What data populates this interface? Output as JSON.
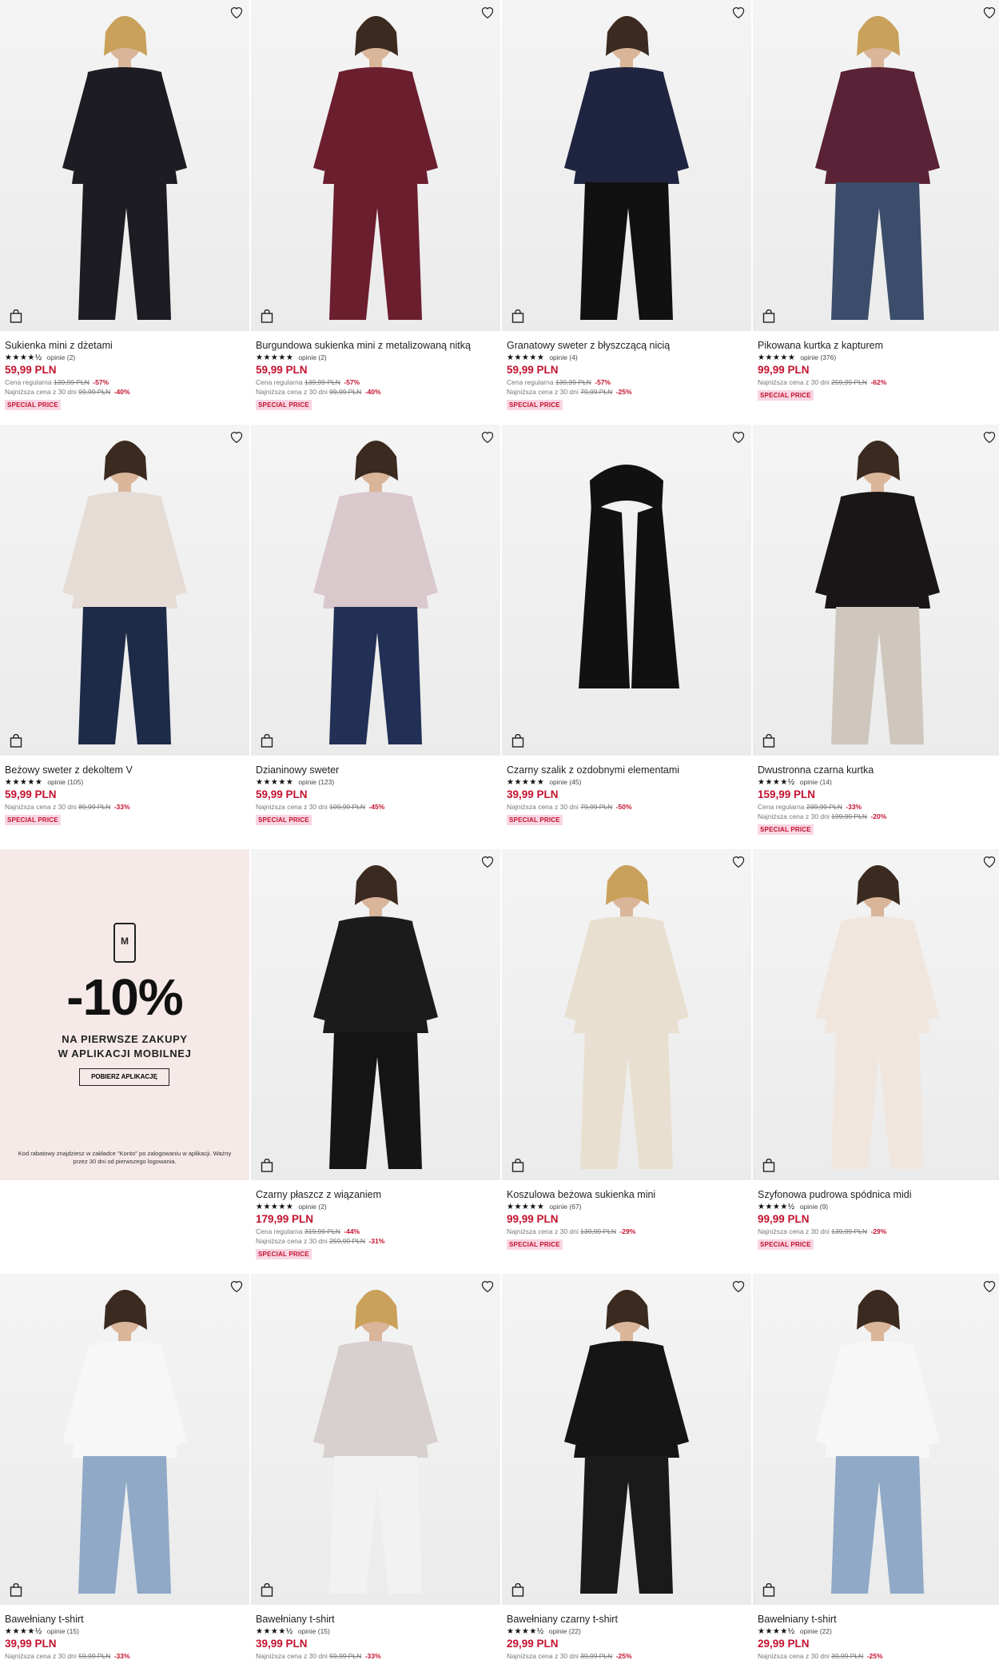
{
  "icons": {
    "wishlist": "heart-outline-icon",
    "add_to_cart": "shopping-bag-icon",
    "phone": "mobile-phone-icon"
  },
  "colors": {
    "price": "#c4122f",
    "badge_bg": "#f9d5e3",
    "badge_text": "#c4122f",
    "promo_bg": "#f5eae8"
  },
  "products": [
    {
      "name": "Sukienka mini z dżetami",
      "stars": "★★★★½",
      "reviews": "opinie (2)",
      "price": "59,99 PLN",
      "ref1_label": "Cena regularna",
      "ref1_old": "139,99 PLN",
      "ref1_pct": "-57%",
      "ref2_label": "Najniższa cena z 30 dni",
      "ref2_old": "99,99 PLN",
      "ref2_pct": "-40%",
      "badge": "SPECIAL PRICE"
    },
    {
      "name": "Burgundowa sukienka mini z metalizowaną nitką",
      "stars": "★★★★★",
      "reviews": "opinie (2)",
      "price": "59,99 PLN",
      "ref1_label": "Cena regularna",
      "ref1_old": "139,99 PLN",
      "ref1_pct": "-57%",
      "ref2_label": "Najniższa cena z 30 dni",
      "ref2_old": "99,99 PLN",
      "ref2_pct": "-40%",
      "badge": "SPECIAL PRICE"
    },
    {
      "name": "Granatowy sweter z błyszczącą nicią",
      "stars": "★★★★★",
      "reviews": "opinie (4)",
      "price": "59,99 PLN",
      "ref1_label": "Cena regularna",
      "ref1_old": "139,99 PLN",
      "ref1_pct": "-57%",
      "ref2_label": "Najniższa cena z 30 dni",
      "ref2_old": "79,99 PLN",
      "ref2_pct": "-25%",
      "badge": "SPECIAL PRICE"
    },
    {
      "name": "Pikowana kurtka z kapturem",
      "stars": "★★★★★",
      "reviews": "opinie (376)",
      "price": "99,99 PLN",
      "ref1_label": "Najniższa cena z 30 dni",
      "ref1_old": "259,99 PLN",
      "ref1_pct": "-62%",
      "badge": "SPECIAL PRICE"
    },
    {
      "name": "Beżowy sweter z dekoltem V",
      "stars": "★★★★★",
      "reviews": "opinie (105)",
      "price": "59,99 PLN",
      "ref1_label": "Najniższa cena z 30 dni",
      "ref1_old": "89,99 PLN",
      "ref1_pct": "-33%",
      "badge": "SPECIAL PRICE"
    },
    {
      "name": "Dzianinowy sweter",
      "stars": "★★★★★",
      "reviews": "opinie (123)",
      "price": "59,99 PLN",
      "ref1_label": "Najniższa cena z 30 dni",
      "ref1_old": "109,99 PLN",
      "ref1_pct": "-45%",
      "badge": "SPECIAL PRICE"
    },
    {
      "name": "Czarny szalik z ozdobnymi elementami",
      "stars": "★★★★★",
      "reviews": "opinie (45)",
      "price": "39,99 PLN",
      "ref1_label": "Najniższa cena z 30 dni",
      "ref1_old": "79,99 PLN",
      "ref1_pct": "-50%",
      "badge": "SPECIAL PRICE"
    },
    {
      "name": "Dwustronna czarna kurtka",
      "stars": "★★★★½",
      "reviews": "opinie (14)",
      "price": "159,99 PLN",
      "ref1_label": "Cena regularna",
      "ref1_old": "239,99 PLN",
      "ref1_pct": "-33%",
      "ref2_label": "Najniższa cena z 30 dni",
      "ref2_old": "199,99 PLN",
      "ref2_pct": "-20%",
      "badge": "SPECIAL PRICE"
    },
    {
      "name": "Czarny płaszcz z wiązaniem",
      "stars": "★★★★★",
      "reviews": "opinie (2)",
      "price": "179,99 PLN",
      "ref1_label": "Cena regularna",
      "ref1_old": "319,99 PLN",
      "ref1_pct": "-44%",
      "ref2_label": "Najniższa cena z 30 dni",
      "ref2_old": "259,99 PLN",
      "ref2_pct": "-31%",
      "badge": "SPECIAL PRICE"
    },
    {
      "name": "Koszulowa beżowa sukienka mini",
      "stars": "★★★★★",
      "reviews": "opinie (67)",
      "price": "99,99 PLN",
      "ref1_label": "Najniższa cena z 30 dni",
      "ref1_old": "139,99 PLN",
      "ref1_pct": "-29%",
      "badge": "SPECIAL PRICE"
    },
    {
      "name": "Szyfonowa pudrowa spódnica midi",
      "stars": "★★★★½",
      "reviews": "opinie (9)",
      "price": "99,99 PLN",
      "ref1_label": "Najniższa cena z 30 dni",
      "ref1_old": "139,99 PLN",
      "ref1_pct": "-29%",
      "badge": "SPECIAL PRICE"
    },
    {
      "name": "Bawełniany t-shirt",
      "stars": "★★★★½",
      "reviews": "opinie (15)",
      "price": "39,99 PLN",
      "ref1_label": "Najniższa cena z 30 dni",
      "ref1_old": "59,99 PLN",
      "ref1_pct": "-33%"
    },
    {
      "name": "Bawełniany t-shirt",
      "stars": "★★★★½",
      "reviews": "opinie (15)",
      "price": "39,99 PLN",
      "ref1_label": "Najniższa cena z 30 dni",
      "ref1_old": "59,99 PLN",
      "ref1_pct": "-33%"
    },
    {
      "name": "Bawełniany czarny t-shirt",
      "stars": "★★★★½",
      "reviews": "opinie (22)",
      "price": "29,99 PLN",
      "ref1_label": "Najniższa cena z 30 dni",
      "ref1_old": "39,99 PLN",
      "ref1_pct": "-25%"
    },
    {
      "name": "Bawełniany t-shirt",
      "stars": "★★★★½",
      "reviews": "opinie (22)",
      "price": "29,99 PLN",
      "ref1_label": "Najniższa cena z 30 dni",
      "ref1_old": "39,99 PLN",
      "ref1_pct": "-25%"
    }
  ],
  "promo": {
    "phone_letter": "M",
    "discount": "-10%",
    "line1": "NA PIERWSZE ZAKUPY",
    "line2": "W APLIKACJI MOBILNEJ",
    "button": "POBIERZ APLIKACJĘ",
    "note": "Kod rabatowy znajdziesz w zakładce \"Konto\" po zalogowaniu w aplikacji. Ważny przez 30 dni od pierwszego logowania."
  }
}
